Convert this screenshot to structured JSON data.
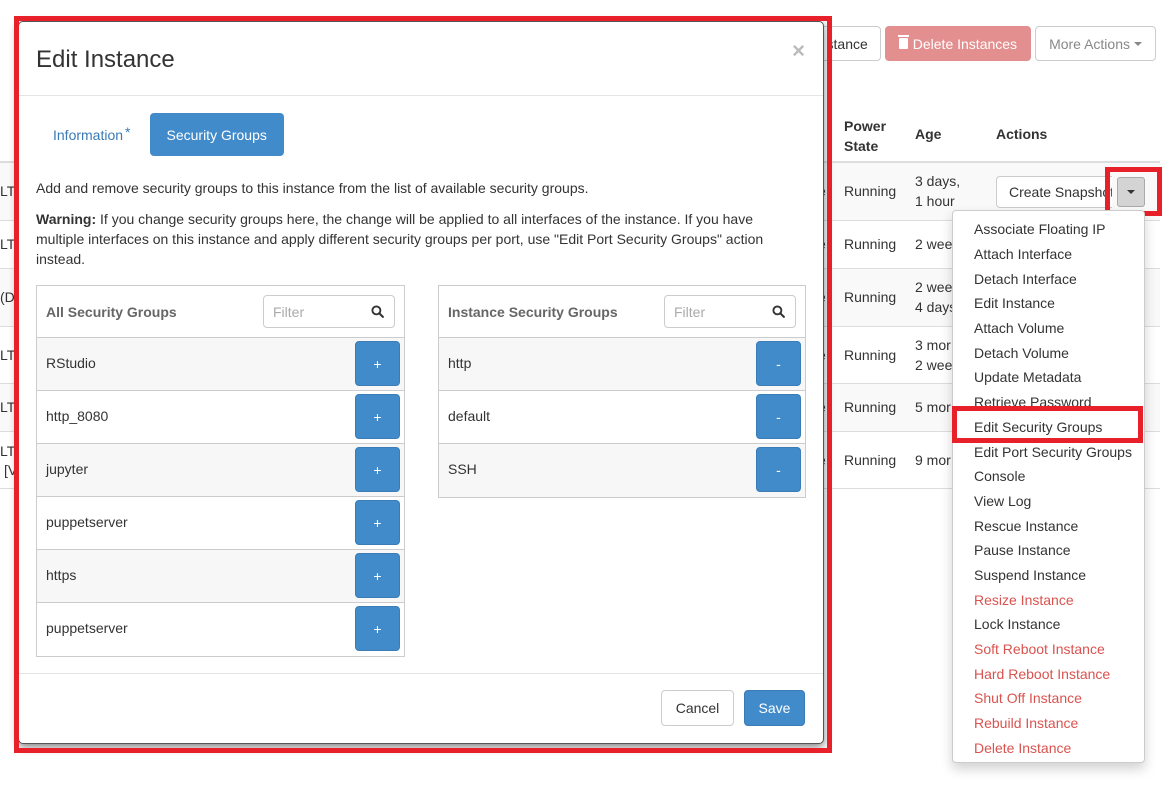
{
  "toolbar": {
    "launch_label": "Launch Instance",
    "launch_visible": "stance",
    "delete_label": "Delete Instances",
    "more_label": "More Actions"
  },
  "table": {
    "headers": {
      "power_state": "Power State",
      "age": "Age",
      "actions": "Actions"
    },
    "rows": [
      {
        "name_fragment": "LTS",
        "task_fragment": "e",
        "power_state": "Running",
        "age_line1": "3 days,",
        "age_line2": "1 hour"
      },
      {
        "name_fragment": "LTS",
        "task_fragment": "e",
        "power_state": "Running",
        "age_line1": "2 wee",
        "age_line2": ""
      },
      {
        "name_fragment": "(Di",
        "task_fragment": "e",
        "power_state": "Running",
        "age_line1": "2 wee",
        "age_line2": "4 days"
      },
      {
        "name_fragment": "LTS",
        "task_fragment": "e",
        "power_state": "Running",
        "age_line1": "3 mor",
        "age_line2": "2 wee"
      },
      {
        "name_fragment": "LTS",
        "task_fragment": "e",
        "power_state": "Running",
        "age_line1": "5 mor",
        "age_line2": ""
      },
      {
        "name_fragment": "LTS",
        "name_fragment2": "[V",
        "task_fragment": "e",
        "power_state": "Running",
        "age_line1": "9 mor",
        "age_line2": ""
      }
    ],
    "row_action_label": "Create Snapshot"
  },
  "dropdown_menu": {
    "items": [
      {
        "label": "Associate Floating IP",
        "danger": false
      },
      {
        "label": "Attach Interface",
        "danger": false
      },
      {
        "label": "Detach Interface",
        "danger": false
      },
      {
        "label": "Edit Instance",
        "danger": false
      },
      {
        "label": "Attach Volume",
        "danger": false
      },
      {
        "label": "Detach Volume",
        "danger": false
      },
      {
        "label": "Update Metadata",
        "danger": false
      },
      {
        "label": "Retrieve Password",
        "danger": false
      },
      {
        "label": "Edit Security Groups",
        "danger": false,
        "highlighted": true
      },
      {
        "label": "Edit Port Security Groups",
        "danger": false
      },
      {
        "label": "Console",
        "danger": false
      },
      {
        "label": "View Log",
        "danger": false
      },
      {
        "label": "Rescue Instance",
        "danger": false
      },
      {
        "label": "Pause Instance",
        "danger": false
      },
      {
        "label": "Suspend Instance",
        "danger": false
      },
      {
        "label": "Resize Instance",
        "danger": true
      },
      {
        "label": "Lock Instance",
        "danger": false
      },
      {
        "label": "Soft Reboot Instance",
        "danger": true
      },
      {
        "label": "Hard Reboot Instance",
        "danger": true
      },
      {
        "label": "Shut Off Instance",
        "danger": true
      },
      {
        "label": "Rebuild Instance",
        "danger": true
      },
      {
        "label": "Delete Instance",
        "danger": true
      }
    ]
  },
  "modal": {
    "title": "Edit Instance",
    "close_glyph": "×",
    "tabs": [
      {
        "label": "Information",
        "required_marker": "*",
        "active": false
      },
      {
        "label": "Security Groups",
        "active": true
      }
    ],
    "description": "Add and remove security groups to this instance from the list of available security groups.",
    "warning_label": "Warning:",
    "warning_text": " If you change security groups here, the change will be applied to all interfaces of the instance. If you have multiple interfaces on this instance and apply different security groups per port, use \"Edit Port Security Groups\" action instead.",
    "all_groups": {
      "title": "All Security Groups",
      "filter_placeholder": "Filter",
      "filter_value": "",
      "items": [
        "RStudio",
        "http_8080",
        "jupyter",
        "puppetserver",
        "https",
        "puppetserver"
      ],
      "button_glyph": "+"
    },
    "instance_groups": {
      "title": "Instance Security Groups",
      "filter_placeholder": "Filter",
      "filter_value": "",
      "items": [
        "http",
        "default",
        "SSH"
      ],
      "button_glyph": "-"
    },
    "cancel_label": "Cancel",
    "save_label": "Save"
  },
  "colors": {
    "primary": "#428bca",
    "danger_text": "#d9534f",
    "danger_button": "#e48f8f",
    "highlight": "#e8202a"
  }
}
